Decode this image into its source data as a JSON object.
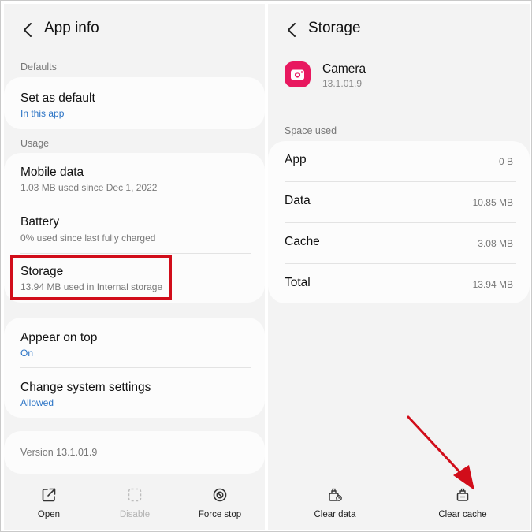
{
  "left": {
    "title": "App info",
    "sections": {
      "defaults": "Defaults",
      "usage": "Usage"
    },
    "set_default": {
      "title": "Set as default",
      "sub": "In this app"
    },
    "mobile_data": {
      "title": "Mobile data",
      "sub": "1.03 MB used since Dec 1, 2022"
    },
    "battery": {
      "title": "Battery",
      "sub": "0% used since last fully charged"
    },
    "storage": {
      "title": "Storage",
      "sub": "13.94 MB used in Internal storage"
    },
    "appear_on_top": {
      "title": "Appear on top",
      "sub": "On"
    },
    "change_system": {
      "title": "Change system settings",
      "sub": "Allowed"
    },
    "version": "Version 13.1.01.9",
    "bottom": {
      "open": "Open",
      "disable": "Disable",
      "force_stop": "Force stop"
    }
  },
  "right": {
    "title": "Storage",
    "app_name": "Camera",
    "app_version": "13.1.01.9",
    "space_used_label": "Space used",
    "rows": [
      {
        "label": "App",
        "value": "0 B"
      },
      {
        "label": "Data",
        "value": "10.85 MB"
      },
      {
        "label": "Cache",
        "value": "3.08 MB"
      },
      {
        "label": "Total",
        "value": "13.94 MB"
      }
    ],
    "bottom": {
      "clear_data": "Clear data",
      "clear_cache": "Clear cache"
    }
  },
  "colors": {
    "accent_blue": "#2a73c5",
    "highlight_red": "#d10d1a",
    "camera_icon": "#e8185f"
  },
  "icons": {
    "back": "chevron-left-icon",
    "open": "open-external-icon",
    "disable": "disable-dashed-icon",
    "force_stop": "force-stop-icon",
    "clear_data": "clear-data-icon",
    "clear_cache": "clear-cache-icon",
    "camera": "camera-app-icon"
  }
}
